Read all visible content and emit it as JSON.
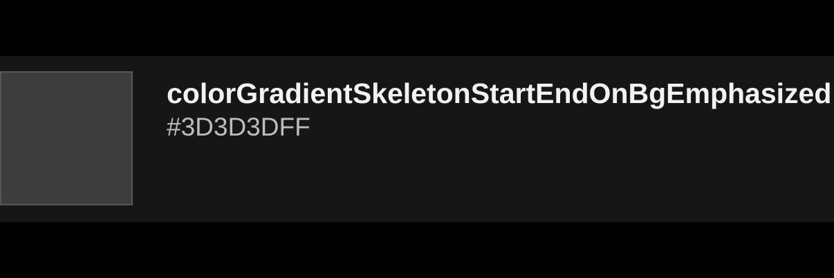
{
  "token": {
    "name": "colorGradientSkeletonStartEndOnBgEmphasized",
    "value": "#3D3D3DFF",
    "swatch_color": "#3D3D3D"
  },
  "colors": {
    "screen_background": "#000000",
    "row_background": "#161616",
    "swatch_border": "#565656",
    "name_text": "#F2F2F2",
    "value_text": "#BDBDBD"
  }
}
